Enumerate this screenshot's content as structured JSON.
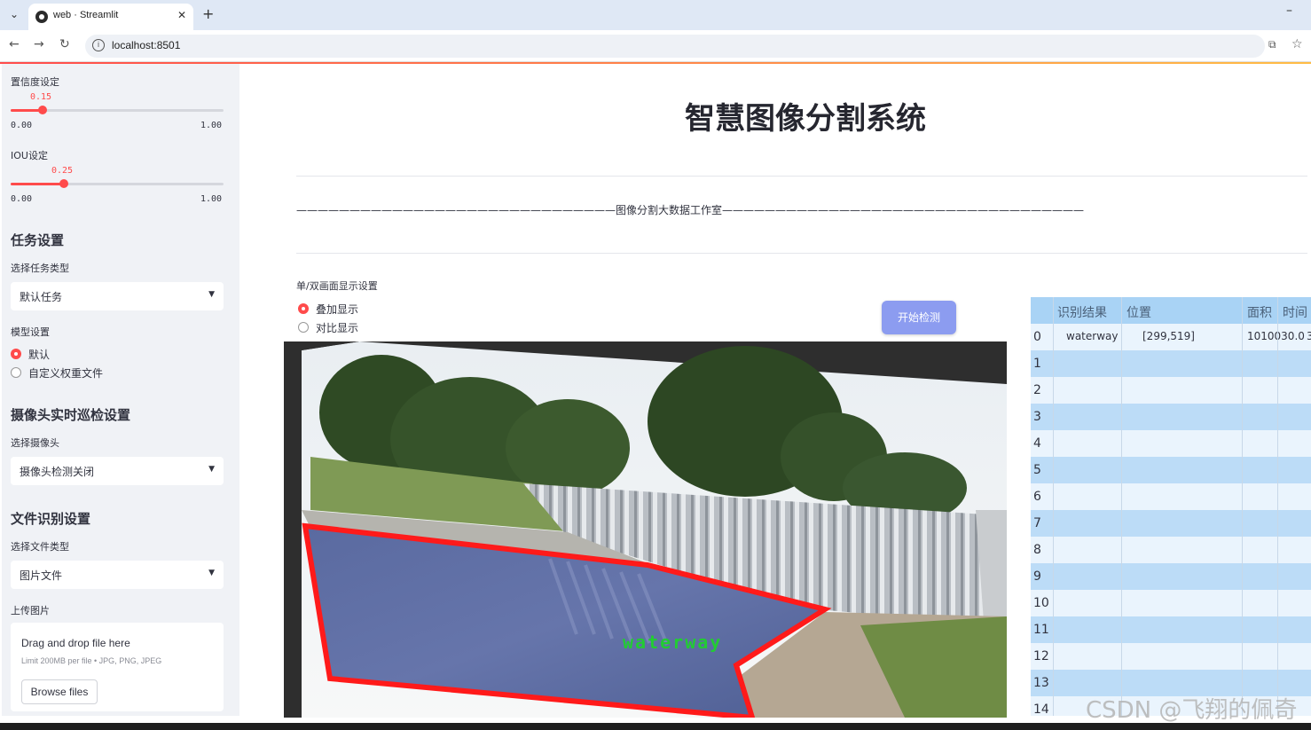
{
  "browser": {
    "tab_title": "web · Streamlit",
    "tab_close": "✕",
    "new_tab": "+",
    "url": "localhost:8501"
  },
  "sidebar": {
    "confidence": {
      "label": "置信度设定",
      "value": "0.15",
      "min": "0.00",
      "max": "1.00",
      "fraction": 0.15
    },
    "iou": {
      "label": "IOU设定",
      "value": "0.25",
      "min": "0.00",
      "max": "1.00",
      "fraction": 0.25
    },
    "task_header": "任务设置",
    "task_type_label": "选择任务类型",
    "task_type_value": "默认任务",
    "model_label": "模型设置",
    "model_options": [
      "默认",
      "自定义权重文件"
    ],
    "camera_header": "摄像头实时巡检设置",
    "camera_label": "选择摄像头",
    "camera_value": "摄像头检测关闭",
    "file_header": "文件识别设置",
    "file_type_label": "选择文件类型",
    "file_type_value": "图片文件",
    "upload_label": "上传图片",
    "drop_text": "Drag and drop file here",
    "drop_limit": "Limit 200MB per file • JPG, PNG, JPEG",
    "browse_label": "Browse files"
  },
  "main": {
    "title": "智慧图像分割系统",
    "subtitle": "——————————————————————————————图像分割大数据工作室——————————————————————————————————",
    "display_label": "单/双画面显示设置",
    "display_options": [
      "叠加显示",
      "对比显示"
    ],
    "start_button": "开始检测",
    "detection_label": "waterway"
  },
  "results": {
    "columns": [
      "识别结果",
      "位置",
      "面积",
      "时间"
    ],
    "rows": [
      {
        "idx": "0",
        "result": "waterway",
        "position": "[299,519]",
        "area": "1010030.0",
        "time": "3"
      },
      {
        "idx": "1"
      },
      {
        "idx": "2"
      },
      {
        "idx": "3"
      },
      {
        "idx": "4"
      },
      {
        "idx": "5"
      },
      {
        "idx": "6"
      },
      {
        "idx": "7"
      },
      {
        "idx": "8"
      },
      {
        "idx": "9"
      },
      {
        "idx": "10"
      },
      {
        "idx": "11"
      },
      {
        "idx": "12"
      },
      {
        "idx": "13"
      },
      {
        "idx": "14"
      }
    ]
  },
  "watermark": "CSDN @飞翔的佩奇",
  "colors": {
    "accent": "#ff4b4b",
    "button": "#8c9cf0",
    "table_header": "#a9d3f5",
    "mask": "#ff1a1a",
    "label": "#22cc33"
  }
}
